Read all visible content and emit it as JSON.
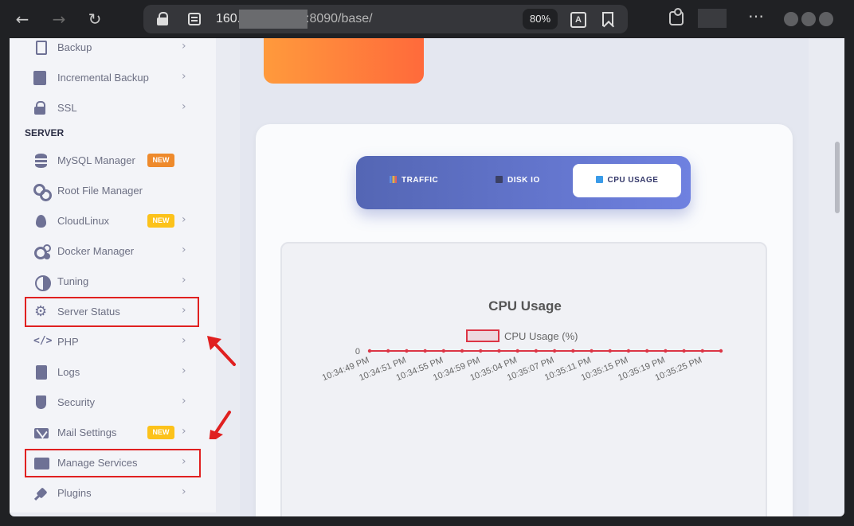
{
  "browser": {
    "url_host": "160.",
    "url_rest": ":8090/base/",
    "zoom": "80%",
    "translate_glyph": "A"
  },
  "sidebar": {
    "section_server": "SERVER",
    "items": [
      {
        "label": "Backup",
        "icon": "file-copy-icon",
        "chevron": "›"
      },
      {
        "label": "Incremental Backup",
        "icon": "save-icon",
        "chevron": "›"
      },
      {
        "label": "SSL",
        "icon": "lock-icon",
        "chevron": "›"
      },
      {
        "label": "MySQL Manager",
        "icon": "database-icon",
        "badge": "NEW"
      },
      {
        "label": "Root File Manager",
        "icon": "link-icon"
      },
      {
        "label": "CloudLinux",
        "icon": "fire-icon",
        "badge": "NEW",
        "chevron": "›"
      },
      {
        "label": "Docker Manager",
        "icon": "cogs-icon",
        "chevron": "›"
      },
      {
        "label": "Tuning",
        "icon": "adjust-icon",
        "chevron": "›"
      },
      {
        "label": "Server Status",
        "icon": "gear-icon",
        "chevron": "›"
      },
      {
        "label": "PHP",
        "icon": "code-icon",
        "chevron": "›"
      },
      {
        "label": "Logs",
        "icon": "document-icon",
        "chevron": "›"
      },
      {
        "label": "Security",
        "icon": "shield-icon",
        "chevron": "›"
      },
      {
        "label": "Mail Settings",
        "icon": "mail-icon",
        "badge": "NEW",
        "chevron": "›"
      },
      {
        "label": "Manage Services",
        "icon": "folder-open-icon",
        "chevron": "›"
      },
      {
        "label": "Plugins",
        "icon": "plug-icon",
        "chevron": "›"
      }
    ]
  },
  "tabs": [
    {
      "label": "TRAFFIC",
      "icon": "bar-chart-icon",
      "active": false
    },
    {
      "label": "DISK IO",
      "icon": "floppy-icon",
      "active": false
    },
    {
      "label": "CPU USAGE",
      "icon": "monitor-icon",
      "active": true
    }
  ],
  "colors": {
    "highlight_box": "#e02020",
    "annotation_arrow": "#e02020",
    "series_line": "#dc3545",
    "badge_orange": "#ee8a2c",
    "badge_yellow": "#fcc21b"
  },
  "chart_data": {
    "type": "line",
    "title": "CPU Usage",
    "legend": [
      "CPU Usage (%)"
    ],
    "legend_position": "top-center",
    "x": [
      "10:34:49 PM",
      "",
      "10:34:51 PM",
      "",
      "10:34:55 PM",
      "",
      "10:34:59 PM",
      "",
      "10:35:04 PM",
      "",
      "10:35:07 PM",
      "",
      "10:35:11 PM",
      "",
      "10:35:15 PM",
      "",
      "10:35:19 PM",
      "",
      "10:35:25 PM",
      ""
    ],
    "series": [
      {
        "name": "CPU Usage (%)",
        "values": [
          0,
          0,
          0,
          0,
          0,
          0,
          0,
          0,
          0,
          0,
          0,
          0,
          0,
          0,
          0,
          0,
          0,
          0,
          0,
          0
        ]
      }
    ],
    "y_ticks": [
      "0"
    ],
    "grid": false
  }
}
